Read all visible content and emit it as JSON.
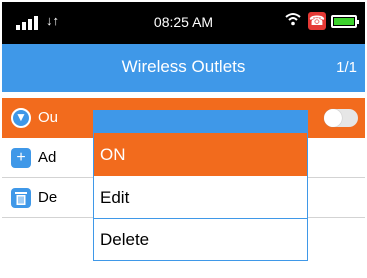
{
  "status_bar": {
    "time": "08:25 AM",
    "data_arrows": "↓↑",
    "wifi_icon": "wifi-icon",
    "phone_icon": "missed-call-icon",
    "battery_color": "#3cd12c"
  },
  "header": {
    "title": "Wireless Outlets",
    "page": "1/1",
    "color": "#3f98e8"
  },
  "rows": [
    {
      "label": "Ou",
      "icon": "outlet-icon"
    },
    {
      "label": "Ad",
      "icon": "add-icon"
    },
    {
      "label": "De",
      "icon": "trash-icon"
    }
  ],
  "menu": {
    "items": [
      "ON",
      "Edit",
      "Delete"
    ],
    "highlight_color": "#f26b1d"
  }
}
